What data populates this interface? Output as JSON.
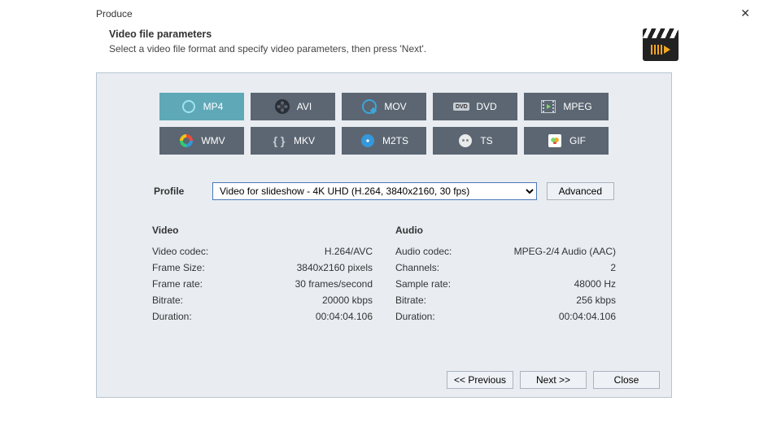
{
  "window": {
    "title": "Produce"
  },
  "header": {
    "heading": "Video file parameters",
    "sub": "Select a video file format and specify video parameters, then press 'Next'."
  },
  "formats": {
    "items": [
      {
        "label": "MP4",
        "selected": true,
        "icon": "mp4"
      },
      {
        "label": "AVI",
        "selected": false,
        "icon": "avi"
      },
      {
        "label": "MOV",
        "selected": false,
        "icon": "mov"
      },
      {
        "label": "DVD",
        "selected": false,
        "icon": "dvd"
      },
      {
        "label": "MPEG",
        "selected": false,
        "icon": "mpeg"
      },
      {
        "label": "WMV",
        "selected": false,
        "icon": "wmv"
      },
      {
        "label": "MKV",
        "selected": false,
        "icon": "mkv"
      },
      {
        "label": "M2TS",
        "selected": false,
        "icon": "m2ts"
      },
      {
        "label": "TS",
        "selected": false,
        "icon": "ts"
      },
      {
        "label": "GIF",
        "selected": false,
        "icon": "gif"
      }
    ]
  },
  "profile": {
    "label": "Profile",
    "value": "Video for slideshow - 4K UHD (H.264, 3840x2160, 30 fps)",
    "advanced": "Advanced"
  },
  "video": {
    "heading": "Video",
    "rows": [
      {
        "k": "Video codec:",
        "v": "H.264/AVC"
      },
      {
        "k": "Frame Size:",
        "v": "3840x2160 pixels"
      },
      {
        "k": "Frame rate:",
        "v": "30 frames/second"
      },
      {
        "k": "Bitrate:",
        "v": "20000 kbps"
      },
      {
        "k": "Duration:",
        "v": "00:04:04.106"
      }
    ]
  },
  "audio": {
    "heading": "Audio",
    "rows": [
      {
        "k": "Audio codec:",
        "v": "MPEG-2/4 Audio (AAC)"
      },
      {
        "k": "Channels:",
        "v": "2"
      },
      {
        "k": "Sample rate:",
        "v": "48000 Hz"
      },
      {
        "k": "Bitrate:",
        "v": "256 kbps"
      },
      {
        "k": "Duration:",
        "v": "00:04:04.106"
      }
    ]
  },
  "footer": {
    "previous": "<< Previous",
    "next": "Next >>",
    "close": "Close"
  }
}
